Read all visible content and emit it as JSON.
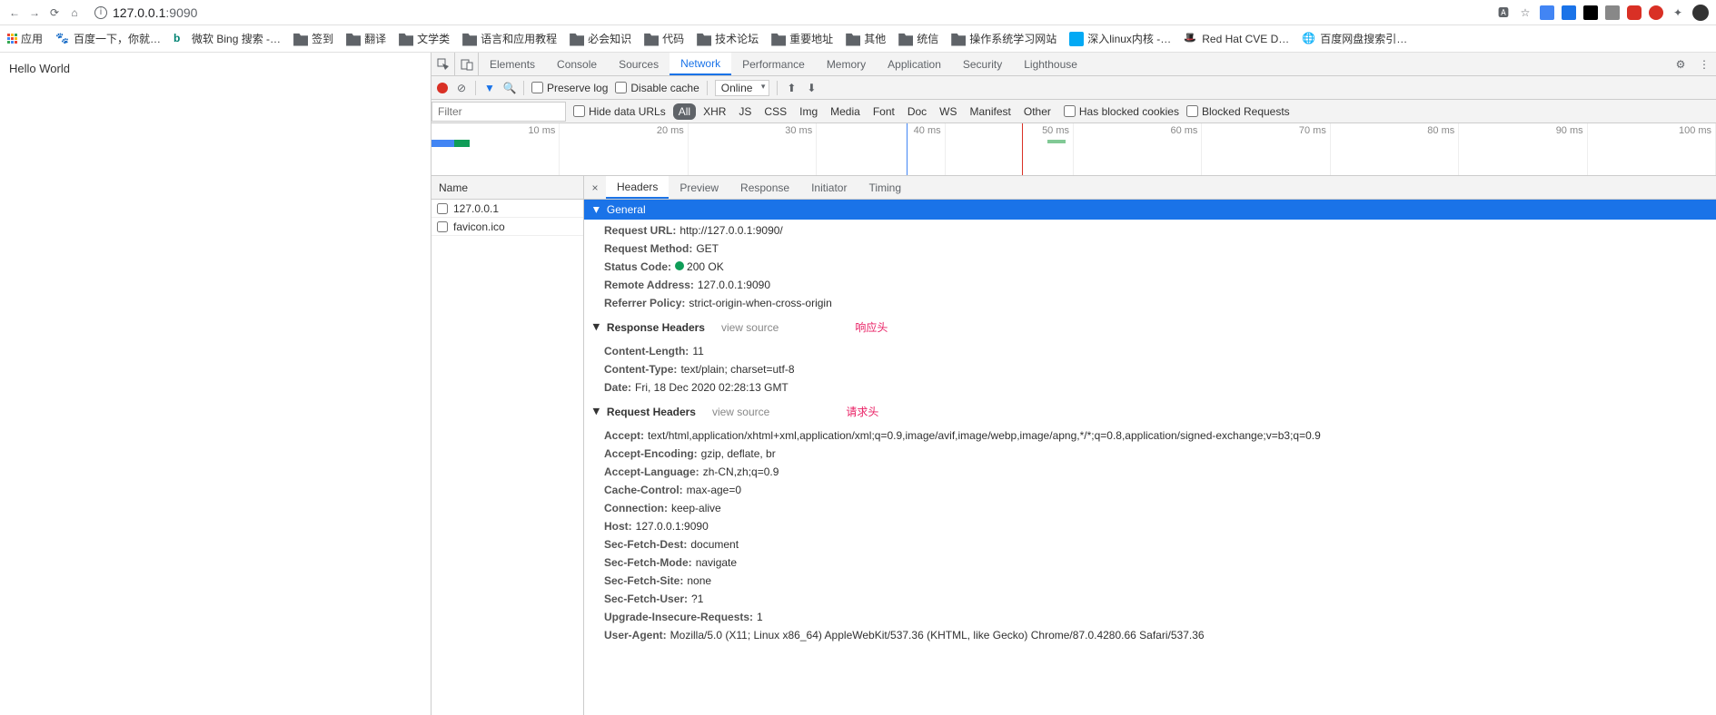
{
  "browser": {
    "url_host": "127.0.0.1",
    "url_port": ":9090"
  },
  "bookmarks": {
    "apps": "应用",
    "items": [
      "百度一下，你就…",
      "微软 Bing 搜索 -…",
      "签到",
      "翻译",
      "文学类",
      "语言和应用教程",
      "必会知识",
      "代码",
      "技术论坛",
      "重要地址",
      "其他",
      "统信",
      "操作系统学习网站",
      "深入linux内核 -…",
      "Red Hat CVE D…",
      "百度网盘搜索引…"
    ]
  },
  "page": {
    "content": "Hello World"
  },
  "devtools": {
    "tabs": [
      "Elements",
      "Console",
      "Sources",
      "Network",
      "Performance",
      "Memory",
      "Application",
      "Security",
      "Lighthouse"
    ],
    "activeTab": "Network",
    "toolbar": {
      "preserve_log": "Preserve log",
      "disable_cache": "Disable cache",
      "throttle": "Online"
    },
    "filterRow": {
      "placeholder": "Filter",
      "hide_data_urls": "Hide data URLs",
      "pills": [
        "All",
        "XHR",
        "JS",
        "CSS",
        "Img",
        "Media",
        "Font",
        "Doc",
        "WS",
        "Manifest",
        "Other"
      ],
      "has_blocked_cookies": "Has blocked cookies",
      "blocked_requests": "Blocked Requests"
    },
    "timeline_ticks": [
      "10 ms",
      "20 ms",
      "30 ms",
      "40 ms",
      "50 ms",
      "60 ms",
      "70 ms",
      "80 ms",
      "90 ms",
      "100 ms"
    ],
    "requestList": {
      "header": "Name",
      "rows": [
        "127.0.0.1",
        "favicon.ico"
      ]
    },
    "detail": {
      "tabs": [
        "Headers",
        "Preview",
        "Response",
        "Initiator",
        "Timing"
      ],
      "activeTab": "Headers",
      "general_label": "General",
      "general": [
        {
          "k": "Request URL:",
          "v": "http://127.0.0.1:9090/"
        },
        {
          "k": "Request Method:",
          "v": "GET"
        },
        {
          "k": "Status Code:",
          "v": "200  OK",
          "status": true
        },
        {
          "k": "Remote Address:",
          "v": "127.0.0.1:9090"
        },
        {
          "k": "Referrer Policy:",
          "v": "strict-origin-when-cross-origin"
        }
      ],
      "response_headers_label": "Response Headers",
      "view_source": "view source",
      "response_annotation": "响应头",
      "response_headers": [
        {
          "k": "Content-Length:",
          "v": "11"
        },
        {
          "k": "Content-Type:",
          "v": "text/plain; charset=utf-8"
        },
        {
          "k": "Date:",
          "v": "Fri, 18 Dec 2020 02:28:13 GMT"
        }
      ],
      "request_headers_label": "Request Headers",
      "request_annotation": "请求头",
      "request_headers": [
        {
          "k": "Accept:",
          "v": "text/html,application/xhtml+xml,application/xml;q=0.9,image/avif,image/webp,image/apng,*/*;q=0.8,application/signed-exchange;v=b3;q=0.9"
        },
        {
          "k": "Accept-Encoding:",
          "v": "gzip, deflate, br"
        },
        {
          "k": "Accept-Language:",
          "v": "zh-CN,zh;q=0.9"
        },
        {
          "k": "Cache-Control:",
          "v": "max-age=0"
        },
        {
          "k": "Connection:",
          "v": "keep-alive"
        },
        {
          "k": "Host:",
          "v": "127.0.0.1:9090"
        },
        {
          "k": "Sec-Fetch-Dest:",
          "v": "document"
        },
        {
          "k": "Sec-Fetch-Mode:",
          "v": "navigate"
        },
        {
          "k": "Sec-Fetch-Site:",
          "v": "none"
        },
        {
          "k": "Sec-Fetch-User:",
          "v": "?1"
        },
        {
          "k": "Upgrade-Insecure-Requests:",
          "v": "1"
        },
        {
          "k": "User-Agent:",
          "v": "Mozilla/5.0 (X11; Linux x86_64) AppleWebKit/537.36 (KHTML, like Gecko) Chrome/87.0.4280.66 Safari/537.36"
        }
      ]
    }
  }
}
